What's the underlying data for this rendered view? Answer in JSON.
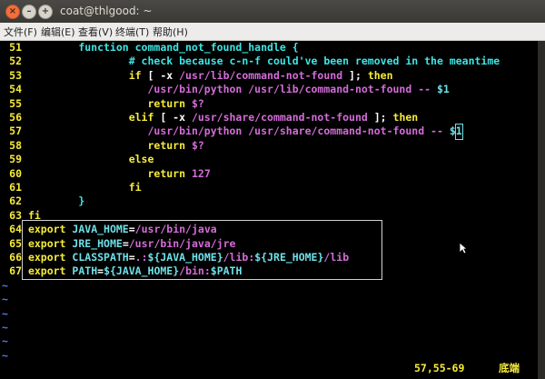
{
  "window": {
    "title": "coat@thlgood: ~"
  },
  "menu": [
    "文件(F)",
    "编辑(E)",
    "查看(V)",
    "终端(T)",
    "帮助(H)"
  ],
  "code": [
    {
      "n": "51",
      "indent": "        ",
      "parts": [
        {
          "c": "cy",
          "t": "function command_not_found_handle {"
        }
      ]
    },
    {
      "n": "52",
      "indent": "                ",
      "parts": [
        {
          "c": "cy",
          "t": "# check because c-n-f could've been removed in the meantime"
        }
      ]
    },
    {
      "n": "53",
      "indent": "                ",
      "parts": [
        {
          "c": "kw",
          "t": "if"
        },
        {
          "c": "wh",
          "t": " [ -x "
        },
        {
          "c": "mg",
          "t": "/usr/lib/command-not-found"
        },
        {
          "c": "wh",
          "t": " ]; "
        },
        {
          "c": "kw",
          "t": "then"
        }
      ]
    },
    {
      "n": "54",
      "indent": "                   ",
      "parts": [
        {
          "c": "mg",
          "t": "/usr/bin/python /usr/lib/command-not-found -- "
        },
        {
          "c": "ex",
          "t": "$1"
        }
      ]
    },
    {
      "n": "55",
      "indent": "                   ",
      "parts": [
        {
          "c": "kw",
          "t": "return"
        },
        {
          "c": "wh",
          "t": " "
        },
        {
          "c": "mg",
          "t": "$?"
        }
      ]
    },
    {
      "n": "56",
      "indent": "                ",
      "parts": [
        {
          "c": "kw",
          "t": "elif"
        },
        {
          "c": "wh",
          "t": " [ -x "
        },
        {
          "c": "mg",
          "t": "/usr/share/command-not-found"
        },
        {
          "c": "wh",
          "t": " ]; "
        },
        {
          "c": "kw",
          "t": "then"
        }
      ]
    },
    {
      "n": "57",
      "indent": "                   ",
      "parts": [
        {
          "c": "mg",
          "t": "/usr/bin/python /usr/share/command-not-found -- "
        },
        {
          "c": "ex",
          "t": "$"
        },
        {
          "c": "ex cursor",
          "t": "1"
        }
      ]
    },
    {
      "n": "58",
      "indent": "                   ",
      "parts": [
        {
          "c": "kw",
          "t": "return"
        },
        {
          "c": "wh",
          "t": " "
        },
        {
          "c": "mg",
          "t": "$?"
        }
      ]
    },
    {
      "n": "59",
      "indent": "                ",
      "parts": [
        {
          "c": "kw",
          "t": "else"
        }
      ]
    },
    {
      "n": "60",
      "indent": "                   ",
      "parts": [
        {
          "c": "kw",
          "t": "return"
        },
        {
          "c": "wh",
          "t": " "
        },
        {
          "c": "mg",
          "t": "127"
        }
      ]
    },
    {
      "n": "61",
      "indent": "                ",
      "parts": [
        {
          "c": "kw",
          "t": "fi"
        }
      ]
    },
    {
      "n": "62",
      "indent": "        ",
      "parts": [
        {
          "c": "cy",
          "t": "}"
        }
      ]
    },
    {
      "n": "63",
      "indent": "",
      "parts": [
        {
          "c": "kw",
          "t": "fi"
        }
      ]
    },
    {
      "n": "64",
      "indent": "",
      "parts": [
        {
          "c": "kw",
          "t": "export"
        },
        {
          "c": "wh",
          "t": " "
        },
        {
          "c": "ex",
          "t": "JAVA_HOME"
        },
        {
          "c": "wh",
          "t": "="
        },
        {
          "c": "mg",
          "t": "/usr/bin/java"
        }
      ]
    },
    {
      "n": "65",
      "indent": "",
      "parts": [
        {
          "c": "kw",
          "t": "export"
        },
        {
          "c": "wh",
          "t": " "
        },
        {
          "c": "ex",
          "t": "JRE_HOME"
        },
        {
          "c": "wh",
          "t": "="
        },
        {
          "c": "mg",
          "t": "/usr/bin/java/jre"
        }
      ]
    },
    {
      "n": "66",
      "indent": "",
      "parts": [
        {
          "c": "kw",
          "t": "export"
        },
        {
          "c": "wh",
          "t": " "
        },
        {
          "c": "ex",
          "t": "CLASSPATH"
        },
        {
          "c": "wh",
          "t": "="
        },
        {
          "c": "mg",
          "t": ".:"
        },
        {
          "c": "ex",
          "t": "${JAVA_HOME}"
        },
        {
          "c": "mg",
          "t": "/lib:"
        },
        {
          "c": "ex",
          "t": "${JRE_HOME}"
        },
        {
          "c": "mg",
          "t": "/lib"
        }
      ]
    },
    {
      "n": "67",
      "indent": "",
      "parts": [
        {
          "c": "kw",
          "t": "export"
        },
        {
          "c": "wh",
          "t": " "
        },
        {
          "c": "ex",
          "t": "PATH"
        },
        {
          "c": "wh",
          "t": "="
        },
        {
          "c": "ex",
          "t": "${JAVA_HOME}"
        },
        {
          "c": "mg",
          "t": "/bin:"
        },
        {
          "c": "ex",
          "t": "$PATH"
        }
      ]
    }
  ],
  "tildes": [
    "~",
    "~",
    "~",
    "~",
    "~",
    "~"
  ],
  "status": {
    "position": "57,55-69",
    "scroll": "底端"
  }
}
